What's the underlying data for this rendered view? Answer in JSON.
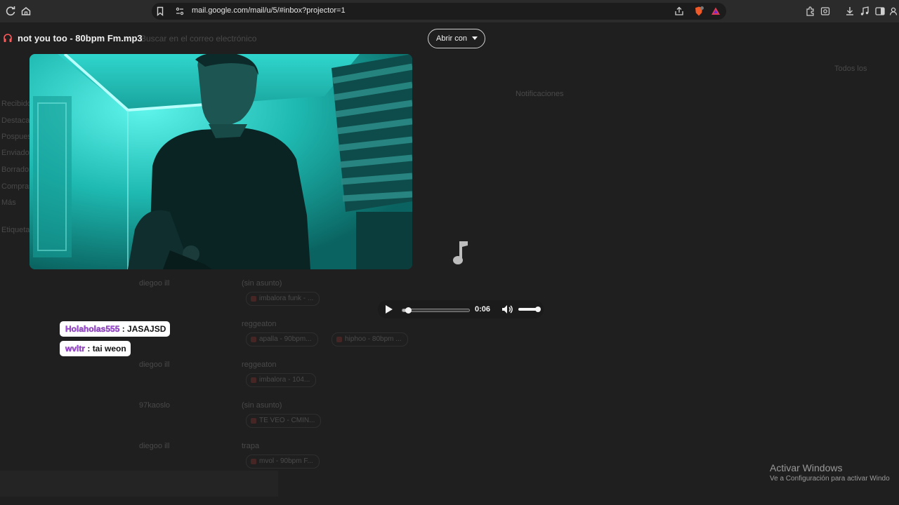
{
  "browser": {
    "url": "mail.google.com/mail/u/5/#inbox?projector=1"
  },
  "projector": {
    "title": "not you too - 80bpm Fm.mp3",
    "open_with_label": "Abrir con"
  },
  "audio_player": {
    "time": "0:06",
    "progress_fraction": 0.09,
    "volume_fraction": 1.0
  },
  "background": {
    "search_hint": "Buscar en el correo electrónico",
    "filter_label": "Todos los",
    "notifications_label": "Notificaciones",
    "sidebar": [
      "Recibidos",
      "Destacados",
      "Pospuestos",
      "Enviados",
      "Borradores",
      "Compras",
      "Más"
    ],
    "labels_heading": "Etiquetas",
    "rows": [
      {
        "sender": "diegoo ill",
        "subject": "(sin asunto)",
        "chips": [
          "imbalora funk - ..."
        ]
      },
      {
        "sender": "",
        "subject": "reggeaton",
        "chips": [
          "apalla - 90bpm...",
          "hiphoo - 80bpm ..."
        ]
      },
      {
        "sender": "diegoo ill",
        "subject": "reggeaton",
        "chips": [
          "imbalora - 104..."
        ]
      },
      {
        "sender": "97kaoslo",
        "subject": "(sin asunto)",
        "chips": [
          "TE VEO - CMIN..."
        ]
      },
      {
        "sender": "diegoo ill",
        "subject": "trapa",
        "chips": [
          "mvol - 90bpm F..."
        ]
      }
    ]
  },
  "chat": [
    {
      "user": "Holaholas555",
      "message": ": JASAJSD"
    },
    {
      "user": "wvltr",
      "message": ": tai weon"
    }
  ],
  "windows_activation": {
    "title": "Activar Windows",
    "subtitle": "Ve a Configuración para activar Windo"
  },
  "icons": {
    "reload": "reload-icon",
    "home": "home-icon",
    "bookmark": "bookmark-icon",
    "site_info": "site-info-icon",
    "share": "share-icon",
    "brave": "brave-shield-icon",
    "alert": "brave-rewards-icon",
    "extensions": "extensions-icon",
    "download": "download-icon",
    "media": "media-icon",
    "sidebar": "sidebar-icon",
    "profile": "profile-icon"
  },
  "colors": {
    "accent_red": "#ff5a5a",
    "username_purple": "#a34fd8",
    "video_teal": "#0e7f7a"
  }
}
